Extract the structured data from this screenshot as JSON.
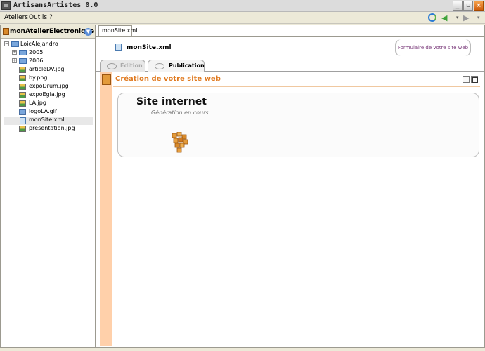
{
  "window": {
    "title": "ArtisansArtistes 0.0"
  },
  "menu": {
    "items": [
      "Ateliers",
      "Outils",
      "?"
    ]
  },
  "sidebar": {
    "workshop_name": "monAtelierElectronique",
    "tree": [
      {
        "label": "LoicAlejandro",
        "type": "root"
      },
      {
        "label": "2005",
        "type": "folder"
      },
      {
        "label": "2006",
        "type": "folder"
      },
      {
        "label": "articleDV.jpg",
        "type": "image"
      },
      {
        "label": "by.png",
        "type": "image"
      },
      {
        "label": "expoDrum.jpg",
        "type": "image"
      },
      {
        "label": "expoEgia.jpg",
        "type": "image"
      },
      {
        "label": "LA.jpg",
        "type": "image"
      },
      {
        "label": "logoLA.gif",
        "type": "gif"
      },
      {
        "label": "monSite.xml",
        "type": "xml",
        "selected": true
      },
      {
        "label": "presentation.jpg",
        "type": "image"
      }
    ]
  },
  "editor": {
    "tab_label": "monSite.xml",
    "header_title": "monSite.xml",
    "form_link": "Formulaire de votre site web",
    "mode_tabs": [
      {
        "label": "Édition",
        "active": false
      },
      {
        "label": "Publication",
        "active": true
      }
    ],
    "section_title": "Création de votre site web",
    "status_title": "Site internet",
    "status_subtitle": "Génération en cours...",
    "accent_color": "#e07a20",
    "sidebar_color": "#ffd0aa"
  }
}
